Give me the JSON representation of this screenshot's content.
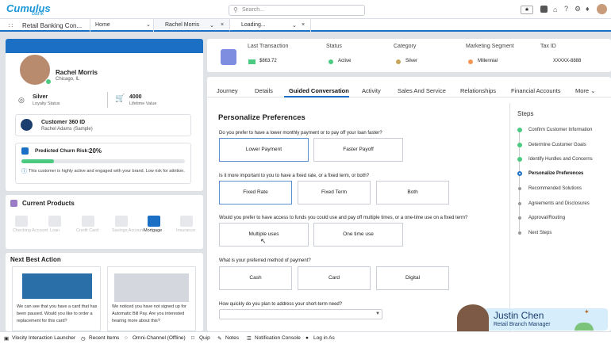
{
  "header": {
    "logo": "Cumulus",
    "logo_sub": "bank",
    "search_placeholder": "Search..."
  },
  "tabs": {
    "app": "Retail Banking Con...",
    "home": "Home",
    "rachel": "Rachel Morris",
    "loading": "Loading..."
  },
  "customer": {
    "name": "Rachel Morris",
    "location": "Chicago, IL",
    "loyalty_value": "Silver",
    "loyalty_label": "Loyalty Status",
    "lifetime_value": "4000",
    "lifetime_label": "Lifetime Value"
  },
  "c360": {
    "title": "Customer 360 ID",
    "sub": "Rachel Adams (Sample)"
  },
  "churn": {
    "label": "Predicted Churn Risk:",
    "value": "20%",
    "progress": 0.2,
    "note": "This customer is highly active and engaged with your brand. Low risk for attrition."
  },
  "products": {
    "title": "Current Products",
    "items": [
      "Checking Account",
      "Loan",
      "Credit Card",
      "Savings Account",
      "Mortgage",
      "Insurance"
    ]
  },
  "nba": {
    "title": "Next Best Action",
    "card1": "We can see that you have a card that has been paused. Would you like to order a replacement for this card?",
    "card2": "We noticed you have not signed up for Automatic Bill Pay. Are you interested hearing more about this?"
  },
  "summary": {
    "last_txn_label": "Last Transaction",
    "last_txn_value": "$863.72",
    "status_label": "Status",
    "status_value": "Active",
    "category_label": "Category",
    "category_value": "Silver",
    "segment_label": "Marketing Segment",
    "segment_value": "Millennial",
    "tax_label": "Tax ID",
    "tax_value": "XXXXX-8888"
  },
  "profile_tabs": [
    "Journey",
    "Details",
    "Guided Conversation",
    "Activity",
    "Sales And Service",
    "Relationships",
    "Financial Accounts",
    "More"
  ],
  "form": {
    "title": "Personalize Preferences",
    "q1": "Do you prefer to have a lower monthly payment or to pay off your loan faster?",
    "q1_opts": [
      "Lower Payment",
      "Faster Payoff"
    ],
    "q2": "Is it more important to you to have a fixed rate, or a fixed term, or both?",
    "q2_opts": [
      "Fixed Rate",
      "Fixed Term",
      "Both"
    ],
    "q3": "Would you prefer to have access to funds you could use and pay off multiple times, or a one-time use on a fixed term?",
    "q3_opts": [
      "Multiple uses",
      "One time use"
    ],
    "q4": "What is your preferred method of payment?",
    "q4_opts": [
      "Cash",
      "Card",
      "Digital"
    ],
    "q5": "How quickly do you plan to address your short-term need?"
  },
  "steps": {
    "title": "Steps",
    "items": [
      "Confirm Customer Information",
      "Determine Customer Goals",
      "Identify Hurdles and Concerns",
      "Personalize Preferences",
      "Recommended Solutions",
      "Agreements and Disclosures",
      "Approval/Routing",
      "Next Steps"
    ],
    "done": 3,
    "current": 3
  },
  "presenter": {
    "name": "Justin Chen",
    "title": "Retail Branch Manager"
  },
  "bottom": [
    "Vlocity Interaction Launcher",
    "Recent Items",
    "Omni-Channel (Offline)",
    "Quip",
    "Notes",
    "Notification Console",
    "Log in As"
  ],
  "colors": {
    "accent": "#1b6fc4",
    "green": "#4bca81",
    "header_blue": "#1b6fc4"
  }
}
